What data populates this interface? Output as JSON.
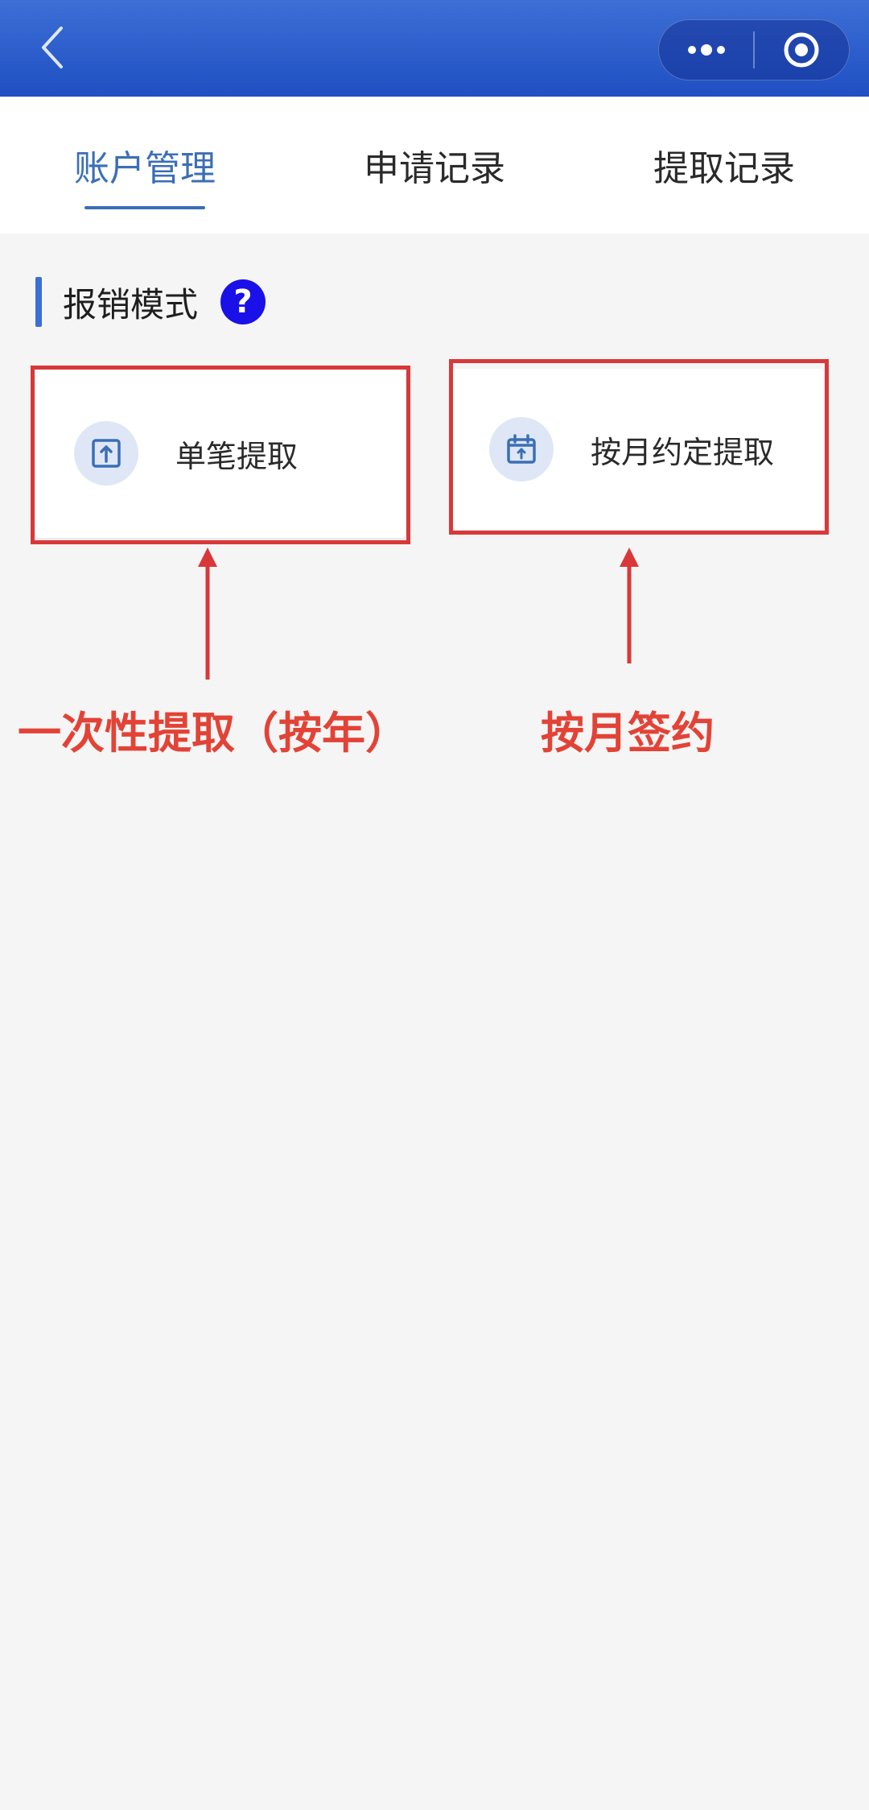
{
  "tabs": [
    {
      "label": "账户管理",
      "active": true
    },
    {
      "label": "申请记录",
      "active": false
    },
    {
      "label": "提取记录",
      "active": false
    }
  ],
  "section": {
    "title": "报销模式",
    "help": "?"
  },
  "cards": [
    {
      "label": "单笔提取",
      "icon": "upload-icon"
    },
    {
      "label": "按月约定提取",
      "icon": "calendar-icon"
    }
  ],
  "annotations": {
    "left": "一次性提取（按年）",
    "right": "按月签约"
  },
  "colors": {
    "header": "#2350c4",
    "accent": "#3b6fb6",
    "annotation": "#d9383a",
    "help": "#1a10e8"
  }
}
